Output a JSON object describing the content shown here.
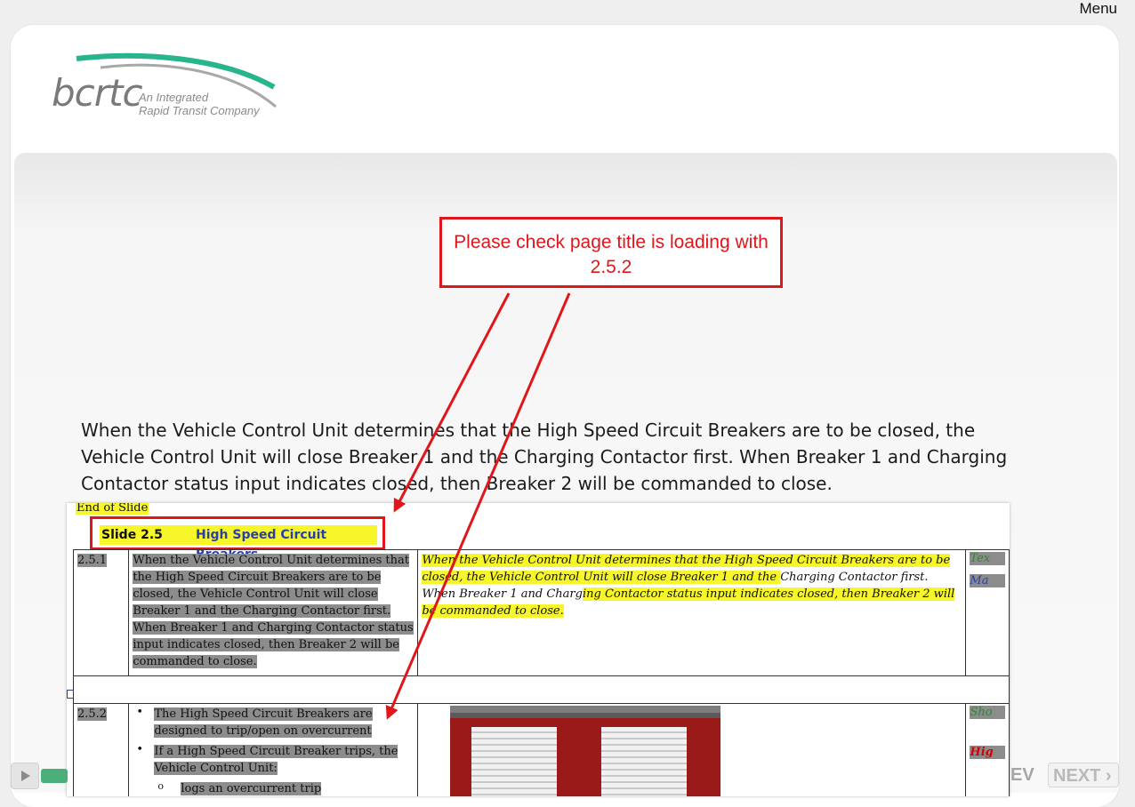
{
  "header": {
    "menu_label": "Menu"
  },
  "logo": {
    "wordmark": "bcrtc",
    "tagline_1": "An Integrated",
    "tagline_2": "Rapid Transit Company"
  },
  "callout": {
    "text": "Please check page title is loading with 2.5.2"
  },
  "content": {
    "paragraph": "When the Vehicle Control Unit determines that the High Speed Circuit Breakers are to be closed, the Vehicle Control Unit will close Breaker 1 and the Charging Contactor first. When Breaker 1 and Charging Contactor status input indicates closed, then Breaker 2 will be commanded to close."
  },
  "document": {
    "end_of_slide": "End of Slide",
    "slide_number": "Slide 2.5",
    "slide_title": "High Speed Circuit Breakers",
    "rows": [
      {
        "id": "2.5.1",
        "text": "When the Vehicle Control Unit determines that the High Speed Circuit Breakers are to be closed, the Vehicle Control Unit will close Breaker 1 and the Charging Contactor first. When Breaker 1 and Charging Contactor status input indicates closed, then Breaker 2 will be commanded to close.",
        "note_a": "When the Vehicle Control Unit determines that the High Speed Circuit Breakers are to be closed, the Vehicle Control Unit will close Breaker 1 and the ",
        "note_b": "Charging Contactor first. When Breaker 1 and Charg",
        "note_c": "ing Contactor status input indicates closed, then Breaker 2 will be commanded to close.",
        "side_1": "Tex",
        "side_2": "Ma"
      },
      {
        "id": "2.5.2",
        "bullet_1": "The High Speed Circuit Breakers are designed to trip/open on overcurrent",
        "bullet_2": "If a High Speed Circuit Breaker trips, the Vehicle Control Unit:",
        "sub_bullet_1": "logs an overcurrent trip",
        "side_1": "Sho",
        "side_2": "Hig"
      }
    ]
  },
  "footer": {
    "prev_label": "EV",
    "next_label": "NEXT ›"
  },
  "colors": {
    "callout_red": "#e0161b",
    "highlight_yellow": "#f6f62a",
    "progress_green": "#4caf7a"
  }
}
